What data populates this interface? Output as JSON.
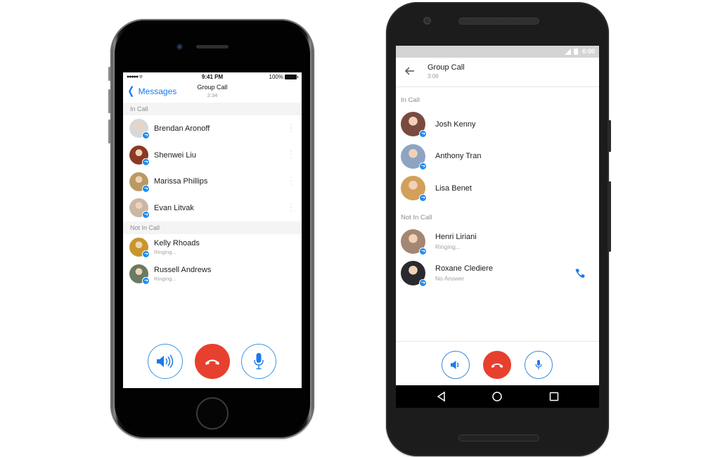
{
  "ios": {
    "status_bar": {
      "signal": "●●●●● ᯤ",
      "time": "9:41 PM",
      "battery": "100%"
    },
    "nav": {
      "back_label": "Messages",
      "title": "Group Call",
      "duration": "2:34"
    },
    "sections": [
      {
        "label": "In Call",
        "participants": [
          {
            "name": "Brendan Aronoff",
            "status": "",
            "avatar_color": "#d8d8d8"
          },
          {
            "name": "Shenwei Liu",
            "status": "",
            "avatar_color": "#8a3a24"
          },
          {
            "name": "Marissa Phillips",
            "status": "",
            "avatar_color": "#b89a62"
          },
          {
            "name": "Evan Litvak",
            "status": "",
            "avatar_color": "#c9b8a4"
          }
        ]
      },
      {
        "label": "Not In Call",
        "participants": [
          {
            "name": "Kelly Rhoads",
            "status": "Ringing...",
            "avatar_color": "#c9962a"
          },
          {
            "name": "Russell Andrews",
            "status": "Ringing...",
            "avatar_color": "#6b7a62"
          }
        ]
      }
    ],
    "controls": {
      "speaker": "speaker-icon",
      "end_call": "end-call-icon",
      "mute": "microphone-icon"
    }
  },
  "android": {
    "status_bar": {
      "time": "6:00"
    },
    "toolbar": {
      "title": "Group Call",
      "duration": "3:06"
    },
    "sections": [
      {
        "label": "In Call",
        "participants": [
          {
            "name": "Josh Kenny",
            "status": "",
            "avatar_color": "#7a4a40"
          },
          {
            "name": "Anthony Tran",
            "status": "",
            "avatar_color": "#8ea4c2"
          },
          {
            "name": "Lisa Benet",
            "status": "",
            "avatar_color": "#d2a05a"
          }
        ]
      },
      {
        "label": "Not In Call",
        "participants": [
          {
            "name": "Henri Liriani",
            "status": "Ringing...",
            "avatar_color": "#a48672",
            "callable": false
          },
          {
            "name": "Roxane Clediere",
            "status": "No Answer",
            "avatar_color": "#2a2a2e",
            "callable": true
          }
        ]
      }
    ],
    "controls": {
      "speaker": "speaker-icon",
      "end_call": "end-call-icon",
      "mute": "microphone-icon"
    },
    "navbar": [
      "back",
      "home",
      "recents"
    ]
  },
  "colors": {
    "accent": "#1a7ae8",
    "end_call": "#e8402f",
    "messenger_badge": "#1e8bf0"
  }
}
